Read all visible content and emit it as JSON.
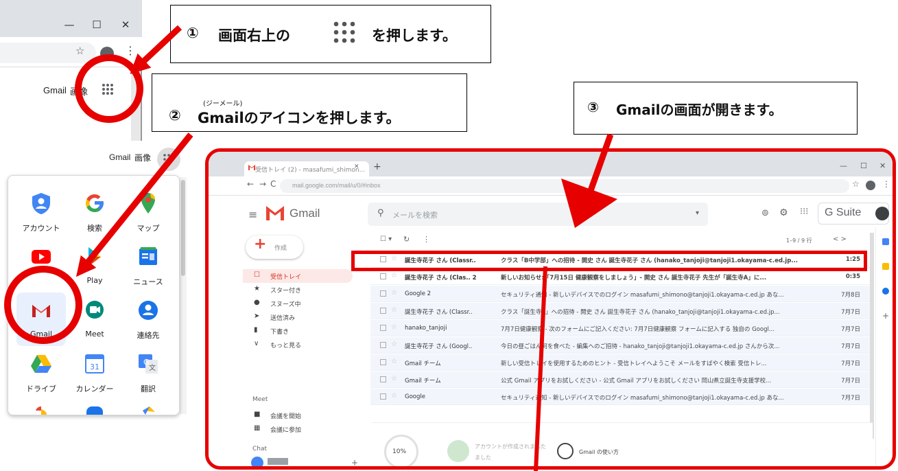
{
  "step1": {
    "number": "①",
    "text_before": "画面右上の",
    "text_after": "を押します。"
  },
  "step2": {
    "number": "②",
    "text": "Gmailのアイコンを押します。",
    "ruby": "(ジーメール)"
  },
  "step3": {
    "number": "③",
    "text": "Gmailの画面が開きます。"
  },
  "chrome": {
    "win_minimize": "—",
    "win_maximize": "☐",
    "win_close": "✕",
    "star": "☆",
    "menu": "⋮",
    "gmail_link": "Gmail",
    "images_link": "画像"
  },
  "launcher": {
    "gmail_link": "Gmail",
    "images_link": "画像",
    "apps": [
      {
        "label": "アカウント",
        "icon": "account-icon",
        "color": "#4285f4"
      },
      {
        "label": "検索",
        "icon": "google-search-icon",
        "color": "#4285f4"
      },
      {
        "label": "マップ",
        "icon": "maps-icon",
        "color": "#34a853"
      },
      {
        "label": "",
        "icon": "youtube-icon",
        "color": "#ff0000"
      },
      {
        "label": "Play",
        "icon": "play-icon",
        "color": "#00c853"
      },
      {
        "label": "ニュース",
        "icon": "news-icon",
        "color": "#4285f4"
      },
      {
        "label": "Gmail",
        "icon": "gmail-icon",
        "color": "#ea4335"
      },
      {
        "label": "Meet",
        "icon": "meet-icon",
        "color": "#00897b"
      },
      {
        "label": "連絡先",
        "icon": "contacts-icon",
        "color": "#1a73e8"
      },
      {
        "label": "ドライブ",
        "icon": "drive-icon",
        "color": "#fbbc04"
      },
      {
        "label": "カレンダー",
        "icon": "calendar-icon",
        "color": "#4285f4"
      },
      {
        "label": "翻訳",
        "icon": "translate-icon",
        "color": "#4285f4"
      }
    ],
    "calendar_day": "31"
  },
  "gmail": {
    "tab_title": "受信トレイ (2) - masafumi_shimon...",
    "tab_close": "✕",
    "new_tab": "+",
    "address": "mail.google.com/mail/u/0/#inbox",
    "logo_text": "Gmail",
    "search_placeholder": "メールを検索",
    "gsuite_text": "G Suite",
    "compose_label": "作成",
    "range": "1–9 / 9 行",
    "pager": "<   >",
    "sidebar": [
      {
        "icon": "☐",
        "label": "受信トレイ",
        "active": true
      },
      {
        "icon": "★",
        "label": "スター付き"
      },
      {
        "icon": "●",
        "label": "スヌーズ中"
      },
      {
        "icon": "➤",
        "label": "送信済み"
      },
      {
        "icon": "▮",
        "label": "下書き"
      },
      {
        "icon": "∨",
        "label": "もっと見る"
      }
    ],
    "meet_title": "Meet",
    "meet_items": [
      {
        "icon": "■",
        "label": "会議を開始"
      },
      {
        "icon": "▦",
        "label": "会議に参加"
      }
    ],
    "chat_title": "Chat",
    "emails": [
      {
        "from": "誕生寺花子 さん (Classr..",
        "subject": "クラス「B中学部」への招待 - 開史 さん 誕生寺花子 さん (hanako_tanjoji@tanjoji1.okayama-c.ed.jp...",
        "date": "1:25",
        "unread": true
      },
      {
        "from": "誕生寺花子 さん (Clas.. 2",
        "subject": "新しいお知らせ:「7月15日 健康観察をしましょう」- 開史 さん 誕生寺花子 先生が「誕生寺A」に...",
        "date": "0:35",
        "unread": true
      },
      {
        "from": "Google 2",
        "subject": "セキュリティ通知 - 新しいデバイスでのログイン masafumi_shimono@tanjoji1.okayama-c.ed.jp あな...",
        "date": "7月8日",
        "unread": false
      },
      {
        "from": "誕生寺花子 さん (Classr..",
        "subject": "クラス「誕生寺A」への招待 - 開史 さん 誕生寺花子 さん (hanako_tanjoji@tanjoji1.okayama-c.ed.jp...",
        "date": "7月7日",
        "unread": false
      },
      {
        "from": "hanako_tanjoji",
        "subject": "7月7日健康観察 - 次のフォームにご記入ください: 7月7日健康観察 フォームに記入する 独自の Googl...",
        "date": "7月7日",
        "unread": false
      },
      {
        "from": "誕生寺花子 さん (Googl..",
        "subject": "今日の昼ごはん何を食べた - 編集へのご招待 - hanako_tanjoji@tanjoji1.okayama-c.ed.jp さんから次...",
        "date": "7月7日",
        "unread": false
      },
      {
        "from": "Gmail チーム",
        "subject": "新しい受信トレイを使用するためのヒント - 受信トレイへようこそ メールをすばやく検索 受信トレ...",
        "date": "7月7日",
        "unread": false
      },
      {
        "from": "Gmail チーム",
        "subject": "公式 Gmail アプリをお試しください - 公式 Gmail アプリをお試しください 岡山県立誕生寺支援学校...",
        "date": "7月7日",
        "unread": false
      },
      {
        "from": "Google",
        "subject": "セキュリティ通知 - 新しいデバイスでのログイン masafumi_shimono@tanjoji1.okayama-c.ed.jp あな...",
        "date": "7月7日",
        "unread": false
      }
    ],
    "progress": "10%",
    "tip_line1": "アカウントが作成されました",
    "tip_line2": "ました",
    "howto": "Gmail の使い方"
  },
  "colors": {
    "annotation_red": "#e60000",
    "gmail_red": "#ea4335",
    "chrome_gray": "#dee1e6"
  }
}
